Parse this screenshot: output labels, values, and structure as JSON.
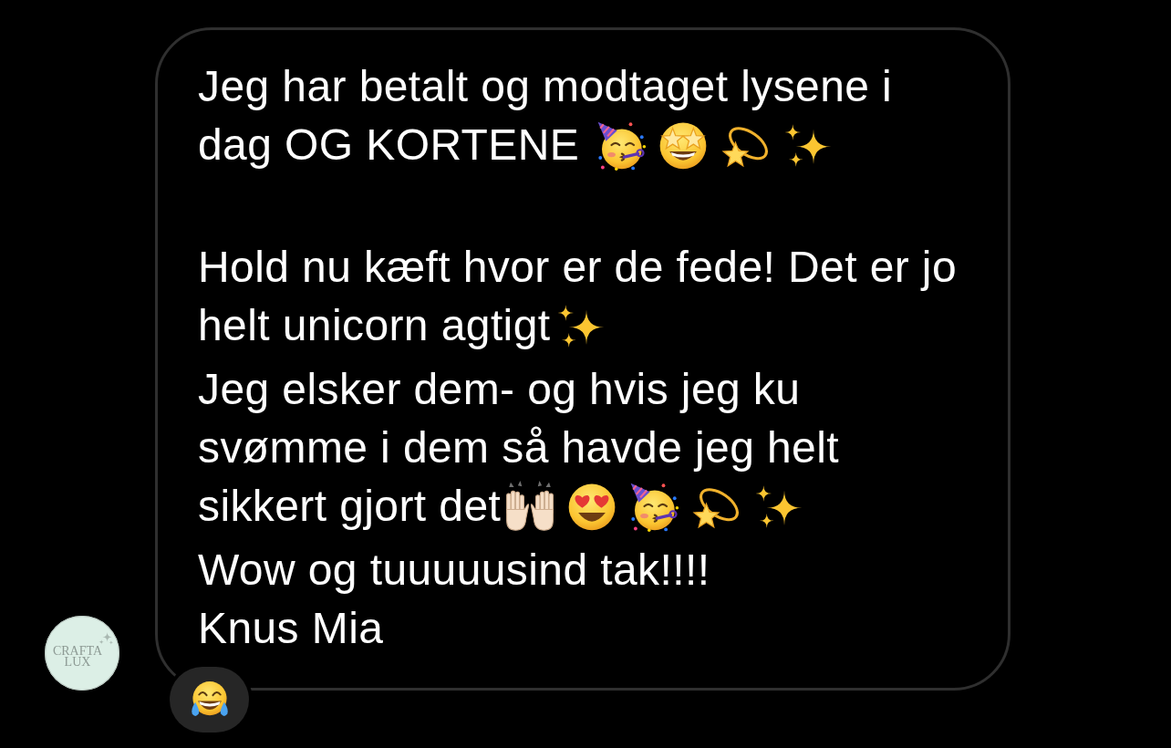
{
  "avatar": {
    "logo_lines": [
      "CRAFTA",
      "LUX"
    ]
  },
  "message": {
    "paragraphs": [
      {
        "lines": [
          {
            "segments": [
              {
                "kind": "text",
                "text": "Jeg har betalt og modtaget lysene i"
              }
            ]
          },
          {
            "segments": [
              {
                "kind": "text",
                "text": "dag OG KORTENE "
              },
              {
                "kind": "partying"
              },
              {
                "kind": "starstruck"
              },
              {
                "kind": "dizzy"
              },
              {
                "kind": "sparkles"
              }
            ]
          }
        ]
      },
      {
        "lines": [
          {
            "segments": [
              {
                "kind": "text",
                "text": "Hold nu kæft hvor er de fede! Det er jo"
              }
            ]
          },
          {
            "segments": [
              {
                "kind": "text",
                "text": "helt unicorn agtigt"
              },
              {
                "kind": "sparkles"
              }
            ]
          },
          {
            "segments": [
              {
                "kind": "text",
                "text": "Jeg elsker dem- og hvis jeg ku"
              }
            ]
          },
          {
            "segments": [
              {
                "kind": "text",
                "text": "svømme i dem så havde jeg helt"
              }
            ]
          },
          {
            "segments": [
              {
                "kind": "text",
                "text": "sikkert gjort det"
              },
              {
                "kind": "raisedhands"
              },
              {
                "kind": "hearteyes"
              },
              {
                "kind": "partying"
              },
              {
                "kind": "dizzy"
              },
              {
                "kind": "sparkles"
              }
            ]
          },
          {
            "segments": [
              {
                "kind": "text",
                "text": "Wow og tuuuuusind tak!!!!"
              }
            ]
          },
          {
            "segments": [
              {
                "kind": "text",
                "text": "Knus Mia"
              }
            ]
          }
        ]
      }
    ],
    "reaction": {
      "kind": "joy"
    }
  }
}
